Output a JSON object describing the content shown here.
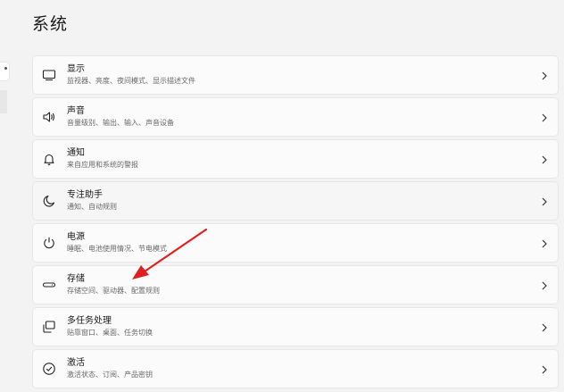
{
  "page": {
    "title": "系统"
  },
  "items": [
    {
      "title": "显示",
      "subtitle": "监视器、亮度、夜间模式、显示描述文件",
      "icon": "monitor-icon"
    },
    {
      "title": "声音",
      "subtitle": "音量级别、输出、输入、声音设备",
      "icon": "speaker-icon"
    },
    {
      "title": "通知",
      "subtitle": "来自应用和系统的警报",
      "icon": "bell-icon"
    },
    {
      "title": "专注助手",
      "subtitle": "通知、自动规则",
      "icon": "moon-icon"
    },
    {
      "title": "电源",
      "subtitle": "睡眠、电池使用情况、节电模式",
      "icon": "power-icon"
    },
    {
      "title": "存储",
      "subtitle": "存储空间、驱动器、配置规则",
      "icon": "drive-icon"
    },
    {
      "title": "多任务处理",
      "subtitle": "贴靠窗口、桌面、任务切换",
      "icon": "multitask-icon"
    },
    {
      "title": "激活",
      "subtitle": "激活状态、订阅、产品密钥",
      "icon": "check-circle-icon"
    }
  ],
  "annotation": {
    "color": "#e02020",
    "target": "存储"
  }
}
